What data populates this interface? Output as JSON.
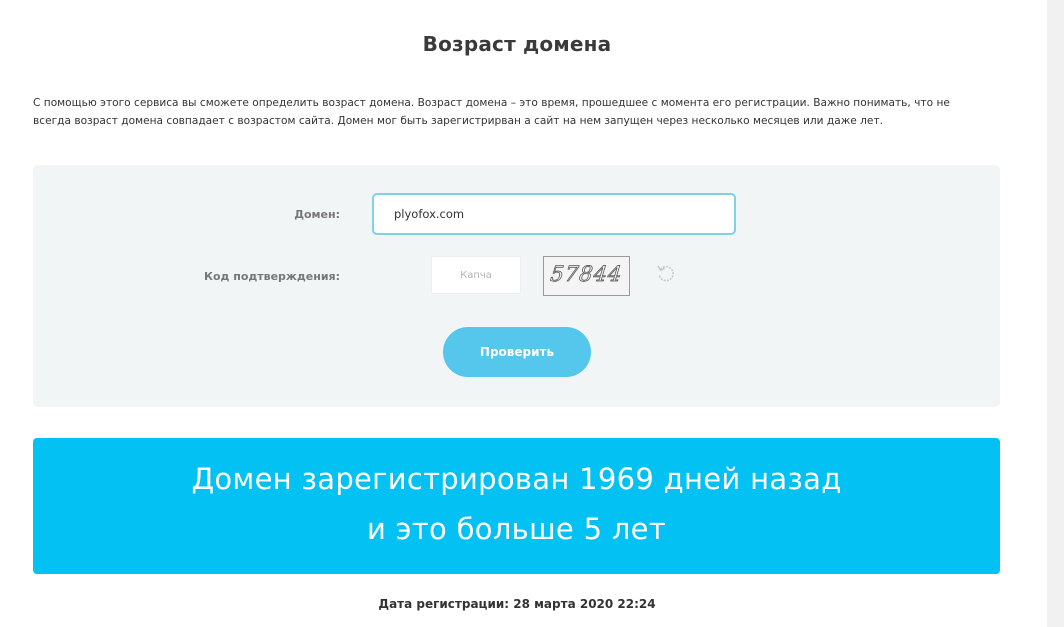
{
  "page": {
    "title": "Возраст домена",
    "intro": "С помощью этого сервиса вы сможете определить возраст домена. Возраст домена – это время, прошедшее с момента его регистрации. Важно понимать, что не всегда возраст домена совпадает с возрастом сайта. Домен мог быть зарегистрирван а сайт на нем запущен через несколько месяцев или даже лет."
  },
  "form": {
    "domain_label": "Домен:",
    "domain_value": "plyofox.com",
    "code_label": "Код подтверждения:",
    "captcha_placeholder": "Капча",
    "captcha_value": "",
    "captcha_image_text": "57844",
    "refresh_icon": "refresh-icon",
    "submit_label": "Проверить"
  },
  "result": {
    "line1": "Домен зарегистрирован 1969 дней назад",
    "line2": "и это больше 5 лет",
    "registration_date": "Дата регистрации: 28 марта 2020 22:24"
  },
  "colors": {
    "accent": "#55c6ec",
    "result_bg": "#03c1f3",
    "panel_bg": "#f2f5f6",
    "input_border": "#7fd0ea"
  }
}
